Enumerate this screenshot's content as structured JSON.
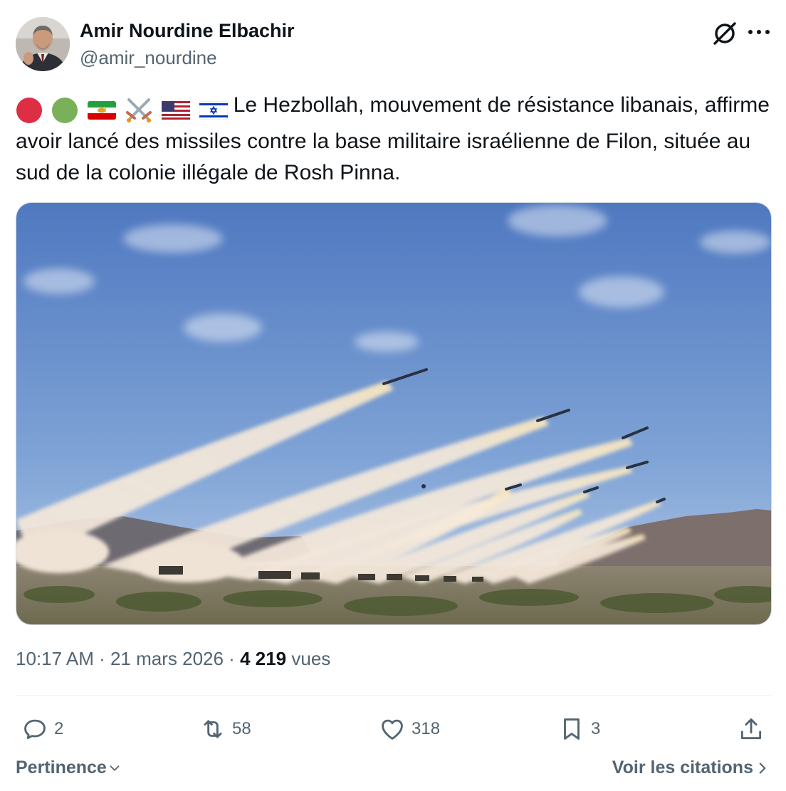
{
  "author": {
    "name": "Amir Nourdine Elbachir",
    "handle": "@amir_nourdine"
  },
  "icons": {
    "grok": "grok-icon",
    "more": "more-icon",
    "reply": "reply-icon",
    "retweet": "retweet-icon",
    "like": "heart-icon",
    "bookmark": "bookmark-icon",
    "share": "share-icon"
  },
  "tweet": {
    "emoji_prefix": [
      "red-circle",
      "green-circle",
      "iran-lion-sun-flag",
      "crossed-swords",
      "us-flag",
      "israel-flag"
    ],
    "text": "Le Hezbollah, mouvement de résistance libanais, affirme avoir lancé des missiles contre la base militaire israélienne de Filon, située au sud de la colonie illégale de Rosh Pinna."
  },
  "meta": {
    "time": "10:17 AM",
    "separator1": " · ",
    "date": "21 mars 2026",
    "separator2": " · ",
    "views_count": "4 219",
    "views_label": " vues"
  },
  "actions": {
    "replies": "2",
    "retweets": "58",
    "likes": "318",
    "bookmarks": "3"
  },
  "footer": {
    "sort_label": "Pertinence",
    "quotes_label": "Voir les citations"
  },
  "colors": {
    "text_primary": "#0f1419",
    "text_secondary": "#536471",
    "divider": "#eff3f4",
    "sky_top": "#4f78c0",
    "sky_bottom": "#a9c2e4"
  }
}
